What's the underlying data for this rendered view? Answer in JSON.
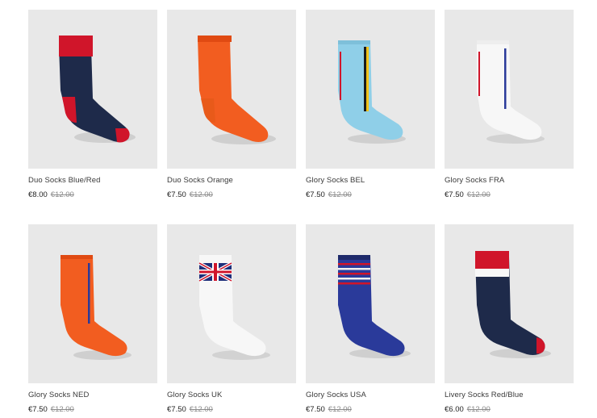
{
  "products": [
    {
      "name": "Duo Socks Blue/Red",
      "price": "€8.00",
      "original_price": "€12.00",
      "image": "sock-duo-blue-red"
    },
    {
      "name": "Duo Socks Orange",
      "price": "€7.50",
      "original_price": "€12.00",
      "image": "sock-duo-orange"
    },
    {
      "name": "Glory Socks BEL",
      "price": "€7.50",
      "original_price": "€12.00",
      "image": "sock-glory-bel"
    },
    {
      "name": "Glory Socks FRA",
      "price": "€7.50",
      "original_price": "€12.00",
      "image": "sock-glory-fra"
    },
    {
      "name": "Glory Socks NED",
      "price": "€7.50",
      "original_price": "€12.00",
      "image": "sock-glory-ned"
    },
    {
      "name": "Glory Socks UK",
      "price": "€7.50",
      "original_price": "€12.00",
      "image": "sock-glory-uk"
    },
    {
      "name": "Glory Socks USA",
      "price": "€7.50",
      "original_price": "€12.00",
      "image": "sock-glory-usa"
    },
    {
      "name": "Livery Socks Red/Blue",
      "price": "€6.00",
      "original_price": "€12.00",
      "image": "sock-livery-red-blue"
    }
  ],
  "colors": {
    "card_bg": "#e8e8e8",
    "navy": "#1e2a4a",
    "red": "#d0152a",
    "orange": "#f25d20",
    "light_blue": "#8fcfe8",
    "white_sock": "#f7f7f7",
    "royal_blue": "#2a3a9a"
  }
}
